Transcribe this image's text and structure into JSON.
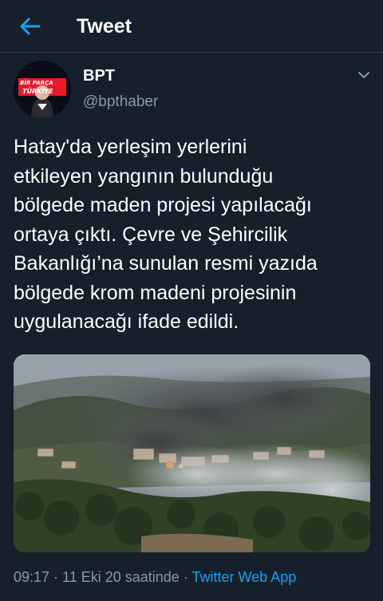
{
  "header": {
    "title": "Tweet",
    "back_icon": "arrow-left-icon",
    "accent": "#1da1f2"
  },
  "author": {
    "name": "BPT",
    "handle": "@bpthaber",
    "avatar_text": "BİR PARÇA TÜRKİYE"
  },
  "tweet": {
    "lines": [
      "Hatay'da yerleşim yerlerini",
      "etkileyen yangının bulunduğu",
      "bölgede maden projesi yapılacağı",
      "ortaya çıktı. Çevre ve Şehircilik",
      "Bakanlığı’na sunulan resmi yazıda",
      "bölgede krom madeni projesinin",
      "uygulanacağı ifade edildi."
    ],
    "media_icon": "wildfire-photo"
  },
  "meta": {
    "time": "09:17",
    "separator": " · ",
    "date": "11 Eki 20 saatinde",
    "app": "Twitter Web App"
  },
  "colors": {
    "background": "#15202b",
    "secondary_text": "#8899a6",
    "divider": "#38444d"
  }
}
